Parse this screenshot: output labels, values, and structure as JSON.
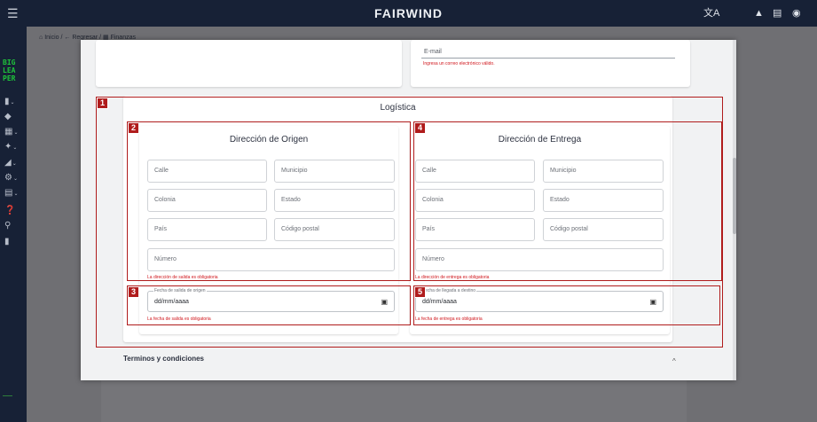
{
  "topbar": {
    "brand": "FAIRWIND",
    "menu_icon": "menu-icon",
    "icons": [
      "translate-icon",
      "bell-icon",
      "chat-icon",
      "account-icon"
    ]
  },
  "sidebar": {
    "logo": [
      "BIG",
      "LEA",
      "PER"
    ],
    "items": [
      {
        "icon": "clipboard-icon"
      },
      {
        "icon": "tag-icon"
      },
      {
        "icon": "grid-icon"
      },
      {
        "icon": "person-icon"
      },
      {
        "icon": "chart-icon"
      },
      {
        "icon": "gear-icon"
      },
      {
        "icon": "card-icon"
      },
      {
        "icon": "help-icon"
      },
      {
        "icon": "search-icon"
      },
      {
        "icon": "book-icon"
      }
    ]
  },
  "breadcrumb": {
    "home": "Inicio",
    "back": "Regresar",
    "current": "Finanzas",
    "separator": "/"
  },
  "contact": {
    "email_label": "E-mail",
    "email_error": "Ingresa un correo electrónico válido."
  },
  "logistica": {
    "title": "Logística",
    "origen": {
      "title": "Dirección de Origen",
      "calle": "Calle",
      "municipio": "Municipio",
      "colonia": "Colonia",
      "estado": "Estado",
      "pais": "País",
      "codigo_postal": "Código postal",
      "numero": "Número",
      "error": "La dirección de salida es obligatoria",
      "date_label": "Fecha de salida de origen",
      "date_value": "dd/mm/aaaa",
      "date_error": "La fecha de salida es obligatoria"
    },
    "entrega": {
      "title": "Dirección de Entrega",
      "calle": "Calle",
      "municipio": "Municipio",
      "colonia": "Colonia",
      "estado": "Estado",
      "pais": "País",
      "codigo_postal": "Código postal",
      "numero": "Número",
      "error": "La dirección de entrega es obligatoria",
      "date_label": "Fecha de llegada a destino",
      "date_value": "dd/mm/aaaa",
      "date_error": "La fecha de entrega es obligatoria"
    }
  },
  "terminos": {
    "title": "Terminos y condiciones",
    "toggle": "^"
  },
  "annotations": [
    "1",
    "2",
    "3",
    "4",
    "5"
  ],
  "colors": {
    "topbar": "#172136",
    "annotation": "#b01c1c",
    "error": "#d0161c",
    "logo": "#1ec43a"
  }
}
